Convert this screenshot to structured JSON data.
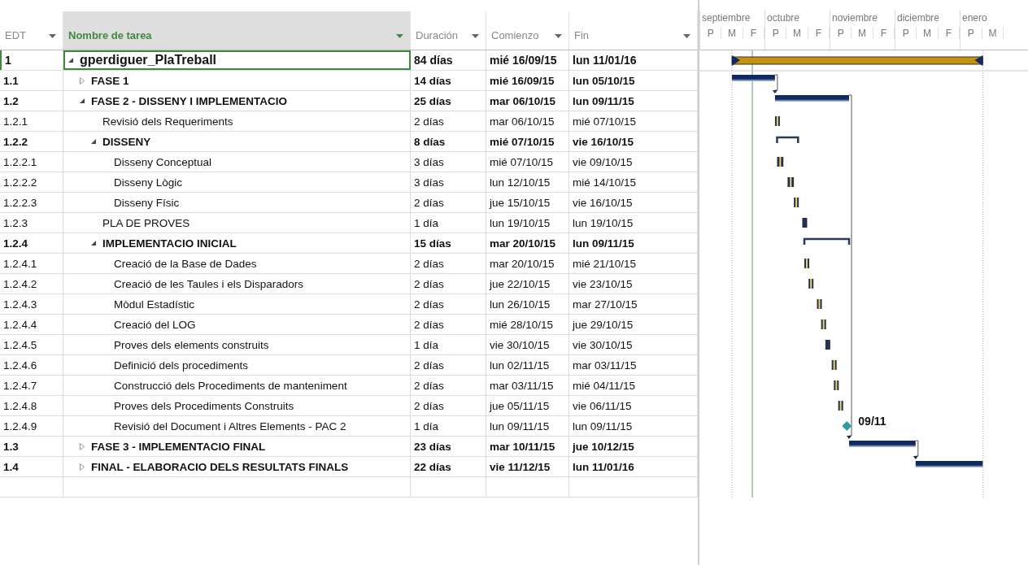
{
  "table": {
    "columns": [
      {
        "label": "EDT",
        "selected": false
      },
      {
        "label": "Nombre de tarea",
        "selected": true
      },
      {
        "label": "Duración",
        "selected": false
      },
      {
        "label": "Comienzo",
        "selected": false
      },
      {
        "label": "Fin",
        "selected": false
      }
    ],
    "tasks": [
      {
        "edt": "1",
        "name": "gperdiguer_PlaTreball",
        "duration": "84 días",
        "start": "mié 16/09/15",
        "finish": "lun 11/01/16",
        "expanded": true,
        "selected": true,
        "kind": "project",
        "children": [
          {
            "edt": "1.1",
            "name": "FASE 1",
            "duration": "14 días",
            "start": "mié 16/09/15",
            "finish": "lun 05/10/15",
            "expanded": false,
            "selected": false,
            "kind": "summary"
          },
          {
            "edt": "1.2",
            "name": "FASE 2 - DISSENY I IMPLEMENTACIO",
            "duration": "25 días",
            "start": "mar 06/10/15",
            "finish": "lun 09/11/15",
            "expanded": true,
            "selected": false,
            "kind": "summary",
            "children": [
              {
                "edt": "1.2.1",
                "name": "Revisió dels Requeriments",
                "duration": "2 días",
                "start": "mar 06/10/15",
                "finish": "mié 07/10/15",
                "selected": false,
                "kind": "task"
              },
              {
                "edt": "1.2.2",
                "name": "DISSENY",
                "duration": "8 días",
                "start": "mié 07/10/15",
                "finish": "vie 16/10/15",
                "expanded": true,
                "selected": false,
                "kind": "group",
                "children": [
                  {
                    "edt": "1.2.2.1",
                    "name": "Disseny Conceptual",
                    "duration": "3 días",
                    "start": "mié 07/10/15",
                    "finish": "vie 09/10/15",
                    "selected": false,
                    "kind": "task"
                  },
                  {
                    "edt": "1.2.2.2",
                    "name": "Disseny Lògic",
                    "duration": "3 días",
                    "start": "lun 12/10/15",
                    "finish": "mié 14/10/15",
                    "selected": false,
                    "kind": "task"
                  },
                  {
                    "edt": "1.2.2.3",
                    "name": "Disseny Físic",
                    "duration": "2 días",
                    "start": "jue 15/10/15",
                    "finish": "vie 16/10/15",
                    "selected": false,
                    "kind": "task"
                  }
                ]
              },
              {
                "edt": "1.2.3",
                "name": "PLA DE PROVES",
                "duration": "1 día",
                "start": "lun 19/10/15",
                "finish": "lun 19/10/15",
                "selected": false,
                "kind": "task"
              },
              {
                "edt": "1.2.4",
                "name": "IMPLEMENTACIO INICIAL",
                "duration": "15 días",
                "start": "mar 20/10/15",
                "finish": "lun 09/11/15",
                "expanded": true,
                "selected": false,
                "kind": "group",
                "children": [
                  {
                    "edt": "1.2.4.1",
                    "name": "Creació de la Base de Dades",
                    "duration": "2 días",
                    "start": "mar 20/10/15",
                    "finish": "mié 21/10/15",
                    "selected": false,
                    "kind": "task"
                  },
                  {
                    "edt": "1.2.4.2",
                    "name": "Creació de les Taules i els Disparadors",
                    "duration": "2 días",
                    "start": "jue 22/10/15",
                    "finish": "vie 23/10/15",
                    "selected": false,
                    "kind": "task"
                  },
                  {
                    "edt": "1.2.4.3",
                    "name": "Mòdul Estadístic",
                    "duration": "2 días",
                    "start": "lun 26/10/15",
                    "finish": "mar 27/10/15",
                    "selected": false,
                    "kind": "task"
                  },
                  {
                    "edt": "1.2.4.4",
                    "name": "Creació del LOG",
                    "duration": "2 días",
                    "start": "mié 28/10/15",
                    "finish": "jue 29/10/15",
                    "selected": false,
                    "kind": "task"
                  },
                  {
                    "edt": "1.2.4.5",
                    "name": "Proves dels elements construits",
                    "duration": "1 día",
                    "start": "vie 30/10/15",
                    "finish": "vie 30/10/15",
                    "selected": false,
                    "kind": "task"
                  },
                  {
                    "edt": "1.2.4.6",
                    "name": "Definició dels procediments",
                    "duration": "2 días",
                    "start": "lun 02/11/15",
                    "finish": "mar 03/11/15",
                    "selected": false,
                    "kind": "task"
                  },
                  {
                    "edt": "1.2.4.7",
                    "name": "Construcció dels Procediments de manteniment",
                    "duration": "2 días",
                    "start": "mar 03/11/15",
                    "finish": "mié 04/11/15",
                    "selected": false,
                    "kind": "task"
                  },
                  {
                    "edt": "1.2.4.8",
                    "name": "Proves dels Procediments Construits",
                    "duration": "2 días",
                    "start": "jue 05/11/15",
                    "finish": "vie 06/11/15",
                    "selected": false,
                    "kind": "task"
                  },
                  {
                    "edt": "1.2.4.9",
                    "name": "Revisió del Document i Altres Elements - PAC 2",
                    "duration": "1 día",
                    "start": "lun 09/11/15",
                    "finish": "lun 09/11/15",
                    "selected": false,
                    "kind": "milestone",
                    "bar_label": "09/11"
                  }
                ]
              }
            ]
          },
          {
            "edt": "1.3",
            "name": "FASE 3 - IMPLEMENTACIO FINAL",
            "duration": "23 días",
            "start": "mar 10/11/15",
            "finish": "jue 10/12/15",
            "expanded": false,
            "selected": false,
            "kind": "summary"
          },
          {
            "edt": "1.4",
            "name": "FINAL - ELABORACIO DELS RESULTATS FINALS",
            "duration": "22 días",
            "start": "vie 11/12/15",
            "finish": "lun 11/01/16",
            "expanded": false,
            "selected": false,
            "kind": "summary"
          }
        ]
      }
    ]
  },
  "timescale": {
    "months": [
      {
        "name": "septiembre",
        "periods": [
          "P",
          "M",
          "F"
        ]
      },
      {
        "name": "octubre",
        "periods": [
          "P",
          "M",
          "F"
        ]
      },
      {
        "name": "noviembre",
        "periods": [
          "P",
          "M",
          "F"
        ]
      },
      {
        "name": "diciembre",
        "periods": [
          "P",
          "M",
          "F"
        ]
      },
      {
        "name": "enero",
        "periods": [
          "P",
          "M"
        ]
      }
    ]
  }
}
